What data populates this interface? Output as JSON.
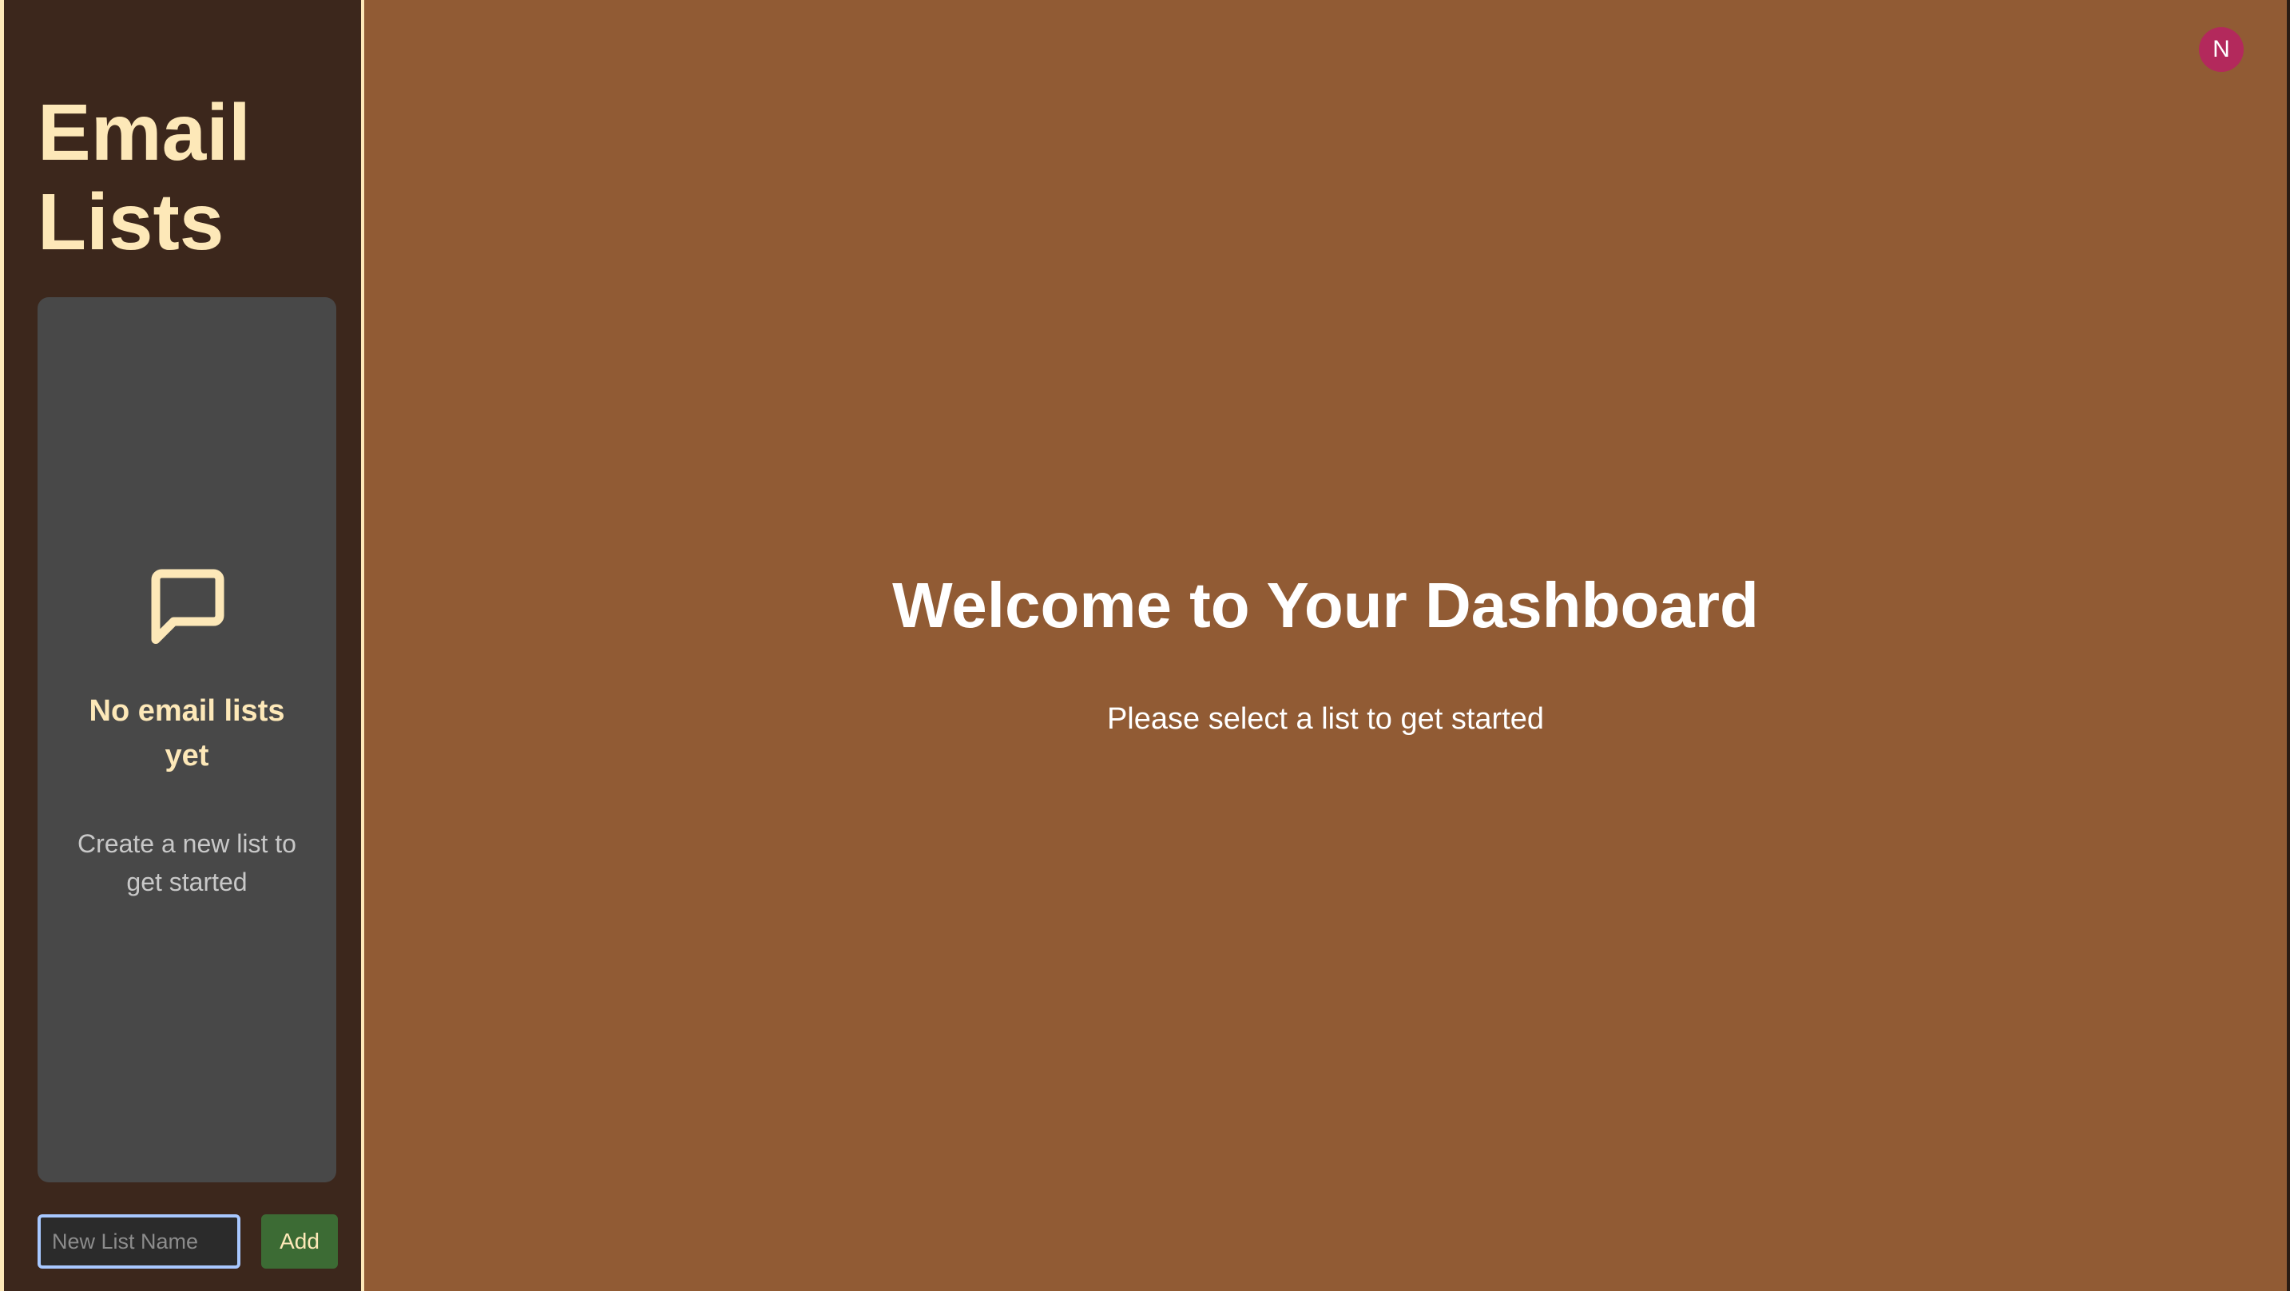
{
  "sidebar": {
    "title": "Email Lists",
    "empty_state": {
      "icon": "message-icon",
      "heading": "No email lists yet",
      "subtext": "Create a new list to get started"
    },
    "new_list": {
      "placeholder": "New List Name",
      "value": "",
      "add_label": "Add"
    }
  },
  "header": {
    "avatar_initial": "N"
  },
  "main": {
    "title": "Welcome to Your Dashboard",
    "subtitle": "Please select a list to get started"
  },
  "colors": {
    "sidebar_bg": "#3c271c",
    "main_bg": "#915b34",
    "accent": "#fde8b8",
    "panel_bg": "#484848",
    "add_button": "#3c6b34",
    "avatar": "#b3295c",
    "input_focus": "#a8c8ff"
  }
}
